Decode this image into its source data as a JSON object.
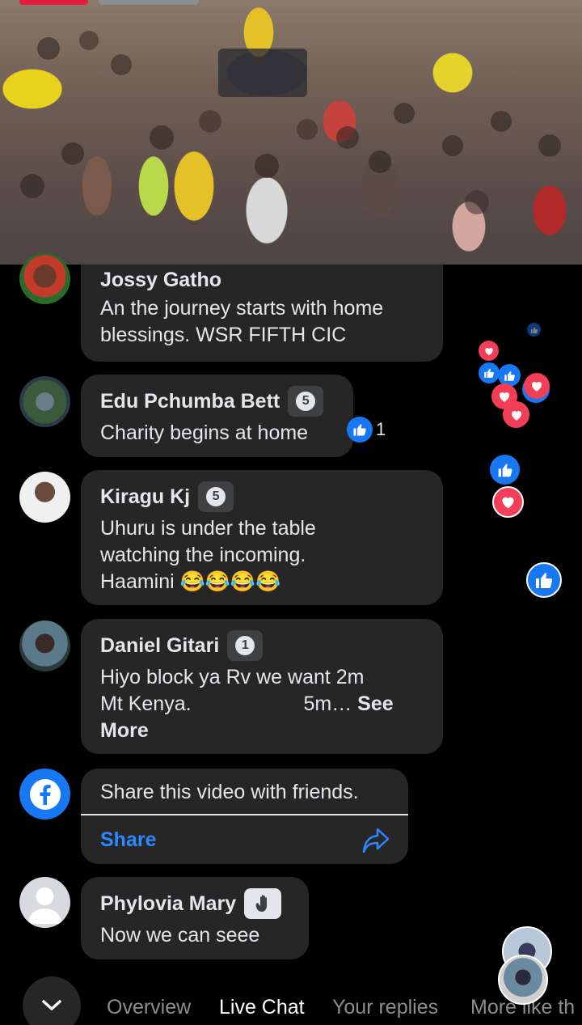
{
  "video": {
    "description_icon": "live-video"
  },
  "comments": [
    {
      "name": "Jossy Gatho",
      "text_lines": [
        "An the journey starts with home",
        "blessings. WSR FIFTH CIC"
      ]
    },
    {
      "name": "Edu Pchumba Bett",
      "badge": "5",
      "text_lines": [
        "Charity begins at home"
      ],
      "like_count": "1"
    },
    {
      "name": "Kiragu Kj",
      "badge": "5",
      "text_lines": [
        "Uhuru is under the table",
        "watching the incoming.",
        "Haamini 😂😂😂😂"
      ]
    },
    {
      "name": "Daniel Gitari",
      "badge": "1",
      "text_lines": [
        "Hiyo block ya Rv we want 2m",
        "Mt Kenya.                    5m…"
      ],
      "see_more": "See",
      "more": "More"
    },
    {
      "name": "Phylovia Mary",
      "text_lines": [
        "Now we can seee"
      ]
    }
  ],
  "share_card": {
    "message": "Share this video with friends.",
    "share_label": "Share"
  },
  "tabs": [
    {
      "label": "Overview",
      "active": false
    },
    {
      "label": "Live Chat",
      "active": true
    },
    {
      "label": "Your replies",
      "active": false
    },
    {
      "label": "More like th",
      "active": false
    }
  ],
  "colors": {
    "accent": "#2d88ff",
    "bubble": "#262626",
    "like": "#1877f2",
    "love": "#f33e58"
  }
}
